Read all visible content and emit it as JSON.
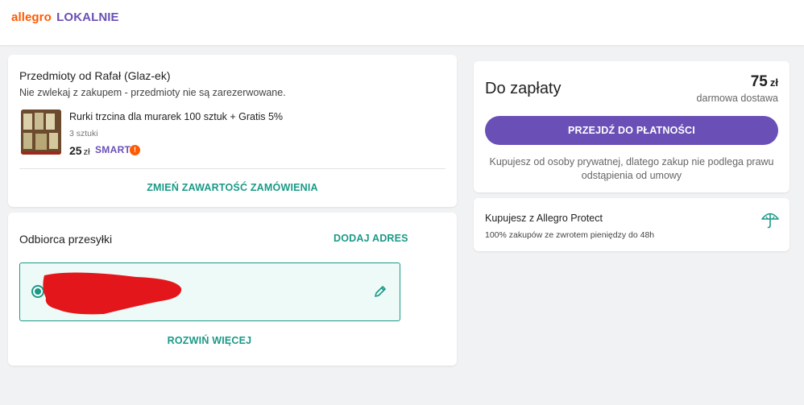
{
  "header": {
    "logo_part1": "allegro",
    "logo_part2": "LOKALNIE"
  },
  "seller_card": {
    "title": "Przedmioty od Rafał (Glaz-ek)",
    "note": "Nie zwlekaj z zakupem - przedmioty nie są zarezerwowane.",
    "item": {
      "title": "Rurki trzcina dla murarek 100 sztuk + Gratis 5%",
      "quantity": "3 sztuki",
      "price": "25",
      "currency": "zł",
      "badge": "SMART",
      "badge_icon": "!"
    },
    "change_order_label": "ZMIEŃ ZAWARTOŚĆ ZAMÓWIENIA"
  },
  "recipient_card": {
    "title": "Odbiorca przesyłki",
    "add_address_label": "DODAJ ADRES",
    "expand_label": "ROZWIŃ WIĘCEJ"
  },
  "payment_card": {
    "title": "Do zapłaty",
    "amount": "75",
    "currency": "zł",
    "shipping": "darmowa dostawa",
    "button_label": "PRZEJDŹ DO PŁATNOŚCI",
    "note": "Kupujesz od osoby prywatnej, dlatego zakup nie podlega prawu odstąpienia od umowy"
  },
  "protect_card": {
    "title": "Kupujesz z Allegro Protect",
    "note": "100% zakupów ze zwrotem pieniędzy do 48h"
  },
  "colors": {
    "accent_green": "#1a9a86",
    "brand_purple": "#6a50b6",
    "brand_orange": "#ff5a00",
    "redaction": "#e3161b"
  },
  "icons": [
    "radio-selected-icon",
    "pencil-icon",
    "umbrella-icon",
    "smart-exclamation-icon"
  ]
}
